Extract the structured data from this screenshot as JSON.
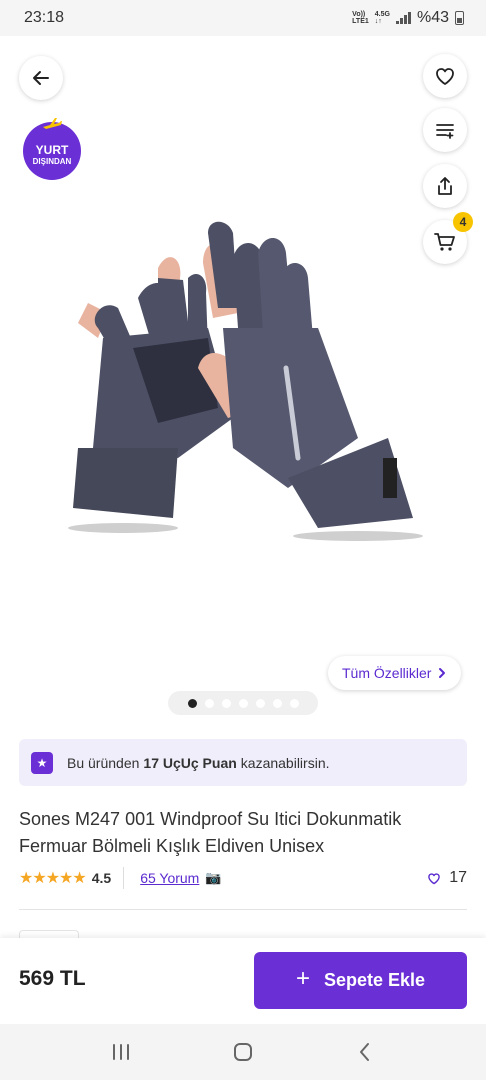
{
  "status_bar": {
    "time": "23:18",
    "network_top": "Vo))",
    "network_bottom": "LTE1",
    "net_type_top": "4.5G",
    "net_type_bottom": "↓↑",
    "battery": "%43"
  },
  "hero": {
    "back_icon": "arrow-left-icon",
    "actions": [
      {
        "icon": "heart-icon"
      },
      {
        "icon": "compare-list-icon"
      },
      {
        "icon": "share-icon"
      },
      {
        "icon": "cart-icon",
        "badge": "4"
      }
    ],
    "badge_line1": "YURT",
    "badge_line2": "DIŞINDAN",
    "specs_button": "Tüm Özellikler",
    "carousel": {
      "count": 7,
      "active_index": 0
    }
  },
  "points_banner": {
    "prefix": "Bu üründen",
    "highlight": "17 UçUç Puan",
    "suffix": "kazanabilirsin."
  },
  "product": {
    "title": "Sones M247 001 Windproof Su Itici Dokunmatik Fermuar Bölmeli Kışlık Eldiven Unisex",
    "stars": "★★★★★",
    "rating": "4.5",
    "reviews": "65 Yorum",
    "favorites": "17"
  },
  "bottom_bar": {
    "price": "569 TL",
    "add_to_cart_plus": "+",
    "add_to_cart": "Sepete Ekle"
  },
  "colors": {
    "brand": "#6b2fd6",
    "brand_text": "#5b2bd0",
    "badge": "#f8c400",
    "star": "#f5a623",
    "points_bg": "#f1eefb"
  }
}
